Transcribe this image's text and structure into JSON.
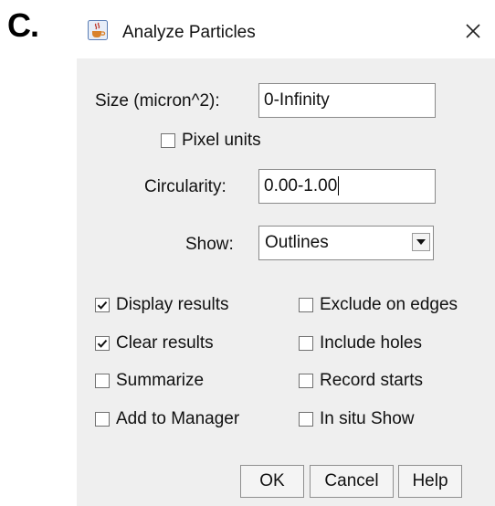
{
  "figure": {
    "panel_letter": "C."
  },
  "window": {
    "title": "Analyze Particles",
    "icon": "java-cup-icon",
    "close_symbol": "✕"
  },
  "form": {
    "size": {
      "label": "Size (micron^2):",
      "value": "0-Infinity"
    },
    "pixel_units": {
      "label": "Pixel units",
      "checked": false
    },
    "circularity": {
      "label": "Circularity:",
      "value": "0.00-1.00"
    },
    "show": {
      "label": "Show:",
      "selected": "Outlines"
    }
  },
  "options": {
    "left": [
      {
        "label": "Display results",
        "checked": true
      },
      {
        "label": "Clear results",
        "checked": true
      },
      {
        "label": "Summarize",
        "checked": false
      },
      {
        "label": "Add to Manager",
        "checked": false
      }
    ],
    "right": [
      {
        "label": "Exclude on edges",
        "checked": false
      },
      {
        "label": "Include holes",
        "checked": false
      },
      {
        "label": "Record starts",
        "checked": false
      },
      {
        "label": "In situ Show",
        "checked": false
      }
    ]
  },
  "buttons": {
    "ok": "OK",
    "cancel": "Cancel",
    "help": "Help"
  },
  "colors": {
    "dialog_background": "#efefef",
    "title_background": "#ffffff",
    "field_border": "#8a8a8a"
  }
}
